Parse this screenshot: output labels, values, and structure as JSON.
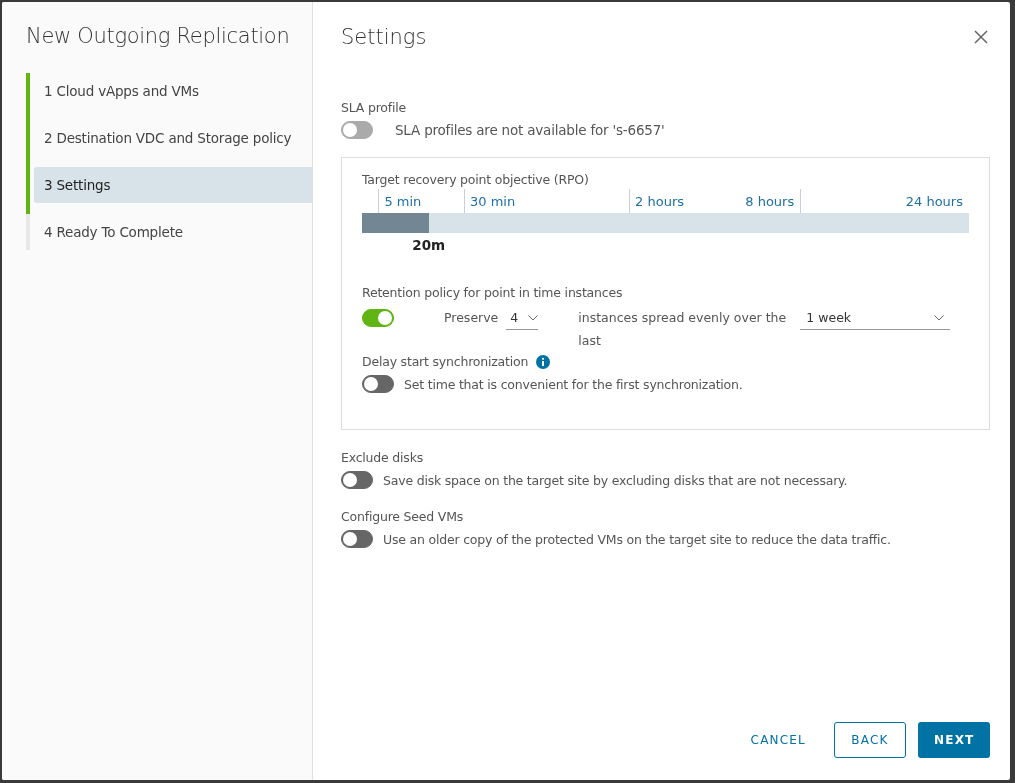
{
  "wizard": {
    "title": "New Outgoing Replication",
    "steps": [
      {
        "label": "1  Cloud vApps and VMs",
        "completed": true,
        "selected": false
      },
      {
        "label": "2  Destination VDC and Storage policy",
        "completed": true,
        "selected": false
      },
      {
        "label": "3  Settings",
        "completed": true,
        "selected": true
      },
      {
        "label": "4  Ready To Complete",
        "completed": false,
        "selected": false
      }
    ]
  },
  "page": {
    "title": "Settings",
    "sla": {
      "label": "SLA profile",
      "toggle": {
        "on": false,
        "disabled": true
      },
      "text": "SLA profiles are not available for 's-6657'"
    },
    "rpo": {
      "label": "Target recovery point objective (RPO)",
      "ticks": [
        "5 min",
        "30 min",
        "2 hours",
        "8 hours",
        "24 hours"
      ],
      "level": 0.11,
      "value": "20m"
    },
    "retention": {
      "label": "Retention policy for point in time instances",
      "toggle": {
        "on": true,
        "disabled": false
      },
      "preserve_label": "Preserve",
      "count": "4",
      "spread_text": "instances spread evenly over the last",
      "period": "1 week"
    },
    "delay": {
      "label": "Delay start synchronization",
      "toggle": {
        "on": false,
        "disabled": false
      },
      "text": "Set time that is convenient for the first synchronization."
    },
    "exclude": {
      "label": "Exclude disks",
      "toggle": {
        "on": false,
        "disabled": false
      },
      "text": "Save disk space on the target site by excluding disks that are not necessary."
    },
    "seed": {
      "label": "Configure Seed VMs",
      "toggle": {
        "on": false,
        "disabled": false
      },
      "text": "Use an older copy of the protected VMs on the target site to reduce the data traffic."
    }
  },
  "buttons": [
    {
      "label": "CANCEL",
      "kind": "flat"
    },
    {
      "label": "BACK",
      "kind": "outline"
    },
    {
      "label": "NEXT",
      "kind": "primary"
    }
  ]
}
